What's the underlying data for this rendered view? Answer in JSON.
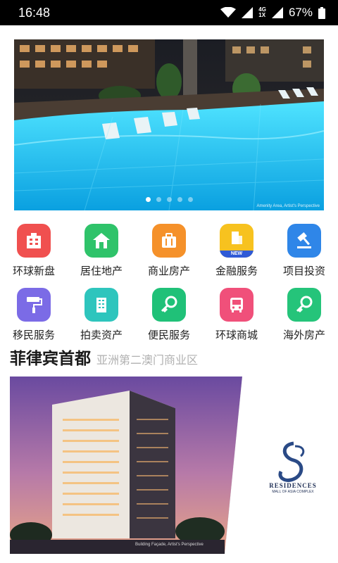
{
  "status_bar": {
    "time": "16:48",
    "network_top": "4G",
    "network_bottom": "1X",
    "battery": "67%"
  },
  "banner": {
    "caption": "Amenity Area, Artist's Perspective",
    "slide_count": 5,
    "active_slide": 1
  },
  "categories": [
    {
      "label": "环球新盘",
      "icon": "building-icon",
      "color": "#f0504f"
    },
    {
      "label": "居住地产",
      "icon": "house-icon",
      "color": "#2fc36a"
    },
    {
      "label": "商业房产",
      "icon": "briefcase-icon",
      "color": "#f5912a"
    },
    {
      "label": "金融服务",
      "icon": "tower-icon",
      "color": "#f7c21f",
      "badge": "NEW"
    },
    {
      "label": "项目投资",
      "icon": "gavel-icon",
      "color": "#2f86e8"
    },
    {
      "label": "移民服务",
      "icon": "paint-roller-icon",
      "color": "#7b6be6"
    },
    {
      "label": "拍卖资产",
      "icon": "office-building-icon",
      "color": "#2ec5bd"
    },
    {
      "label": "便民服务",
      "icon": "key-icon",
      "color": "#20c178"
    },
    {
      "label": "环球商城",
      "icon": "bus-icon",
      "color": "#f0507a"
    },
    {
      "label": "海外房产",
      "icon": "key-icon",
      "color": "#25c47a"
    }
  ],
  "section": {
    "title": "菲律宾首都",
    "subtitle": "亚洲第二澳门商业区"
  },
  "feature": {
    "brand_name": "RESIDENCES",
    "brand_sub": "MALL OF ASIA COMPLEX",
    "caption": "Building Façade, Artist's Perspective"
  }
}
